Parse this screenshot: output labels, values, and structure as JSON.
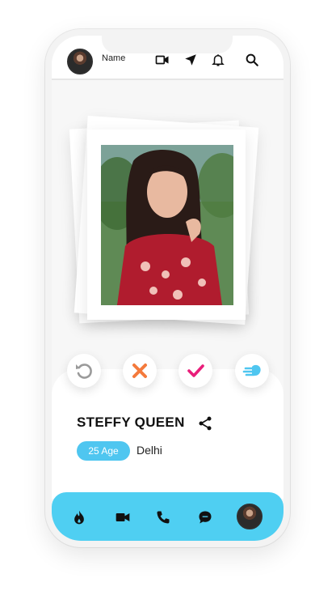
{
  "header": {
    "user_name": "Name",
    "icons": [
      "avatar",
      "video-camera-icon",
      "navigation-arrow-icon",
      "bell-icon",
      "search-icon"
    ]
  },
  "profile": {
    "name": "STEFFY QUEEN",
    "age": "25 Age",
    "city": "Delhi"
  },
  "actions": [
    "rewind-icon",
    "close-icon",
    "check-icon",
    "boost-icon"
  ],
  "bottom_nav": [
    "flame-icon",
    "video-icon",
    "phone-icon",
    "chat-icon",
    "avatar"
  ],
  "colors": {
    "accent": "#4fcff2",
    "badge": "#4fc6f0",
    "reject": "#f47a3c",
    "like": "#e91e7a",
    "rewind": "#9a9a9a"
  }
}
